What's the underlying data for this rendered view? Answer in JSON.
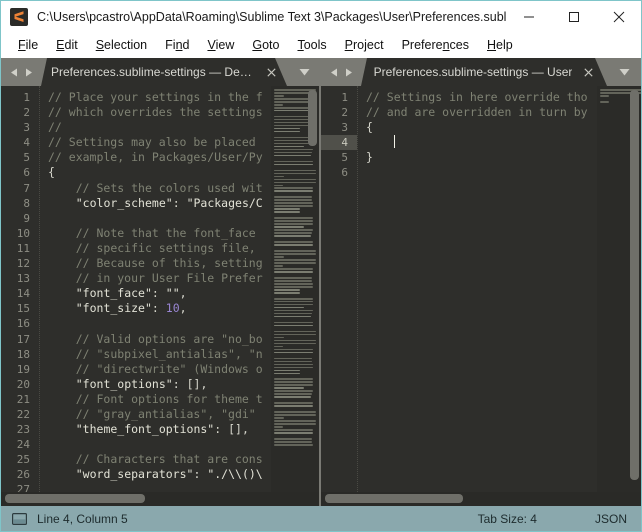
{
  "window": {
    "title": "C:\\Users\\pcastro\\AppData\\Roaming\\Sublime Text 3\\Packages\\User\\Preferences.sublim...",
    "icon": "sublime-text-icon",
    "border_color": "#7fc5c9",
    "controls": {
      "minimize": "minimize-icon",
      "maximize": "maximize-icon",
      "close": "close-icon"
    }
  },
  "menubar": {
    "items": [
      {
        "label": "File",
        "accesskey": "F"
      },
      {
        "label": "Edit",
        "accesskey": "E"
      },
      {
        "label": "Selection",
        "accesskey": "S"
      },
      {
        "label": "Find",
        "accesskey": "n"
      },
      {
        "label": "View",
        "accesskey": "V"
      },
      {
        "label": "Goto",
        "accesskey": "G"
      },
      {
        "label": "Tools",
        "accesskey": "T"
      },
      {
        "label": "Project",
        "accesskey": "P"
      },
      {
        "label": "Preferences",
        "accesskey": "n"
      },
      {
        "label": "Help",
        "accesskey": "H"
      }
    ]
  },
  "panes": [
    {
      "id": "left",
      "tab": {
        "label": "Preferences.sublime-settings — Default",
        "close_icon": "close-icon",
        "active": true
      },
      "nav": {
        "prev_icon": "arrow-left-icon",
        "next_icon": "arrow-right-icon"
      },
      "tab_menu_icon": "chevron-down-icon",
      "lines": [
        {
          "n": 1,
          "text": "// Place your settings in the f"
        },
        {
          "n": 2,
          "text": "// which overrides the settings"
        },
        {
          "n": 3,
          "text": "//"
        },
        {
          "n": 4,
          "text": "// Settings may also be placed"
        },
        {
          "n": 5,
          "text": "// example, in Packages/User/Py"
        },
        {
          "n": 6,
          "text": "{"
        },
        {
          "n": 7,
          "text": "    // Sets the colors used wit"
        },
        {
          "n": 8,
          "text": "    \"color_scheme\": \"Packages/C"
        },
        {
          "n": 9,
          "text": ""
        },
        {
          "n": 10,
          "text": "    // Note that the font_face"
        },
        {
          "n": 11,
          "text": "    // specific settings file,"
        },
        {
          "n": 12,
          "text": "    // Because of this, setting"
        },
        {
          "n": 13,
          "text": "    // in your User File Prefer"
        },
        {
          "n": 14,
          "text": "    \"font_face\": \"\","
        },
        {
          "n": 15,
          "text": "    \"font_size\": 10,"
        },
        {
          "n": 16,
          "text": ""
        },
        {
          "n": 17,
          "text": "    // Valid options are \"no_bo"
        },
        {
          "n": 18,
          "text": "    // \"subpixel_antialias\", \"n"
        },
        {
          "n": 19,
          "text": "    // \"directwrite\" (Windows o"
        },
        {
          "n": 20,
          "text": "    \"font_options\": [],"
        },
        {
          "n": 21,
          "text": "    // Font options for theme t"
        },
        {
          "n": 22,
          "text": "    // \"gray_antialias\", \"gdi\""
        },
        {
          "n": 23,
          "text": "    \"theme_font_options\": [],"
        },
        {
          "n": 24,
          "text": ""
        },
        {
          "n": 25,
          "text": "    // Characters that are cons"
        },
        {
          "n": 26,
          "text": "    \"word_separators\": \"./\\\\()\\"
        },
        {
          "n": 27,
          "text": ""
        }
      ],
      "active_line": null
    },
    {
      "id": "right",
      "tab": {
        "label": "Preferences.sublime-settings — User",
        "close_icon": "close-icon",
        "active": true
      },
      "nav": {
        "prev_icon": "arrow-left-icon",
        "next_icon": "arrow-right-icon"
      },
      "tab_menu_icon": "chevron-down-icon",
      "lines": [
        {
          "n": 1,
          "text": "// Settings in here override tho"
        },
        {
          "n": 2,
          "text": "// and are overridden in turn by"
        },
        {
          "n": 3,
          "text": "{"
        },
        {
          "n": 4,
          "text": "    "
        },
        {
          "n": 5,
          "text": "}"
        },
        {
          "n": 6,
          "text": ""
        }
      ],
      "active_line": 4
    }
  ],
  "statusbar": {
    "icon": "sidebar-toggle-icon",
    "cursor_position": "Line 4, Column 5",
    "tab_size": "Tab Size: 4",
    "syntax": "JSON"
  },
  "colors": {
    "editor_background": "#2e2e2b",
    "gutter_text": "#8e8e84",
    "comment": "#7f8273",
    "foreground": "#d6d6cc",
    "number": "#9a86d4",
    "tabbar": "#7a7a74",
    "statusbar": "#8aa8ad",
    "active_line_gutter": "#50504a"
  }
}
